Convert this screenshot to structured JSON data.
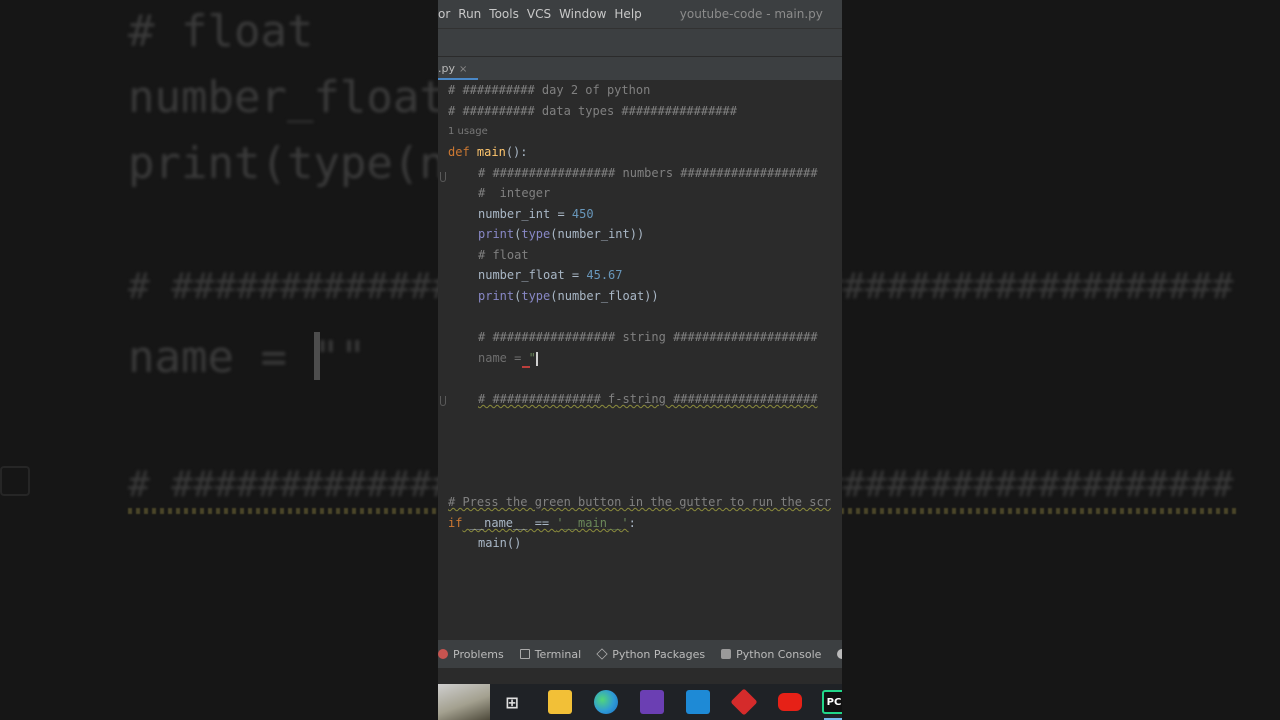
{
  "background": {
    "lines": [
      "# float",
      "number_float",
      "print(type(nu",
      "# #################################################",
      "name = \"\"",
      "# #################################################"
    ]
  },
  "menubar": {
    "items": [
      "or",
      "Run",
      "Tools",
      "VCS",
      "Window",
      "Help"
    ],
    "title": "youtube-code - main.py"
  },
  "tab": {
    "label": ".py",
    "close_glyph": "×"
  },
  "code": {
    "hint_usage": "1 usage",
    "l1": "# ########## day 2 of python",
    "l2": "# ########## data types ################",
    "l3_kw": "def",
    "l3_fn": "main",
    "l3_rest": "():",
    "l4": "# ################# numbers ###################",
    "l5": "#  integer",
    "l6_a": "number_int = ",
    "l6_b": "450",
    "l7_print": "print",
    "l7_open": "(",
    "l7_type": "type",
    "l7_rest": "(number_int))",
    "l8": "# float",
    "l9_a": "number_float = ",
    "l9_b": "45.67",
    "l10_print": "print",
    "l10_open": "(",
    "l10_type": "type",
    "l10_rest": "(number_float))",
    "l11": "# ################# string ####################",
    "l12_a": "name = ",
    "l12_b": "\"",
    "l13": "# ############### f-string ####################",
    "l14": "# Press the green button in the gutter to run the scr",
    "l15_kw": "if",
    "l15_a": " __name__ == ",
    "l15_str": "'__main__'",
    "l15_b": ":",
    "l16": "main()"
  },
  "toolwindows": [
    "Problems",
    "Terminal",
    "Python Packages",
    "Python Console"
  ],
  "taskbar": {
    "apps": [
      "file-explorer",
      "edge",
      "visual-studio",
      "vscode",
      "ruby-app",
      "youtube",
      "pycharm"
    ],
    "pycharm_label": "PC"
  },
  "colors": {
    "editor_bg": "#2b2b2b",
    "chrome_bg": "#3c3f41",
    "comment": "#808080",
    "keyword": "#cc7832",
    "function": "#ffc66d",
    "number": "#6897bb",
    "builtin": "#8888c6"
  }
}
